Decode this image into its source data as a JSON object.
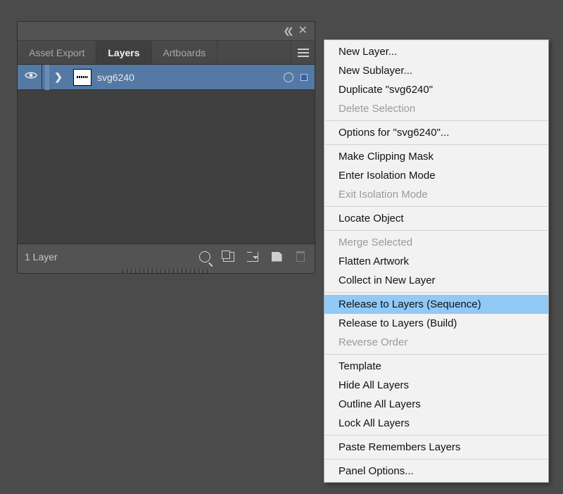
{
  "panel": {
    "tabs": {
      "asset_export": "Asset Export",
      "layers": "Layers",
      "artboards": "Artboards"
    },
    "layer": {
      "name": "svg6240"
    },
    "footer": {
      "count_label": "1 Layer"
    }
  },
  "menu": {
    "items": [
      {
        "label": "New Layer...",
        "disabled": false
      },
      {
        "label": "New Sublayer...",
        "disabled": false
      },
      {
        "label": "Duplicate \"svg6240\"",
        "disabled": false
      },
      {
        "label": "Delete Selection",
        "disabled": true
      },
      {
        "sep": true
      },
      {
        "label": "Options for \"svg6240\"...",
        "disabled": false
      },
      {
        "sep": true
      },
      {
        "label": "Make Clipping Mask",
        "disabled": false
      },
      {
        "label": "Enter Isolation Mode",
        "disabled": false
      },
      {
        "label": "Exit Isolation Mode",
        "disabled": true
      },
      {
        "sep": true
      },
      {
        "label": "Locate Object",
        "disabled": false
      },
      {
        "sep": true
      },
      {
        "label": "Merge Selected",
        "disabled": true
      },
      {
        "label": "Flatten Artwork",
        "disabled": false
      },
      {
        "label": "Collect in New Layer",
        "disabled": false
      },
      {
        "sep": true
      },
      {
        "label": "Release to Layers (Sequence)",
        "disabled": false,
        "highlight": true
      },
      {
        "label": "Release to Layers (Build)",
        "disabled": false
      },
      {
        "label": "Reverse Order",
        "disabled": true
      },
      {
        "sep": true
      },
      {
        "label": "Template",
        "disabled": false
      },
      {
        "label": "Hide All Layers",
        "disabled": false
      },
      {
        "label": "Outline All Layers",
        "disabled": false
      },
      {
        "label": "Lock All Layers",
        "disabled": false
      },
      {
        "sep": true
      },
      {
        "label": "Paste Remembers Layers",
        "disabled": false
      },
      {
        "sep": true
      },
      {
        "label": "Panel Options...",
        "disabled": false
      }
    ]
  }
}
